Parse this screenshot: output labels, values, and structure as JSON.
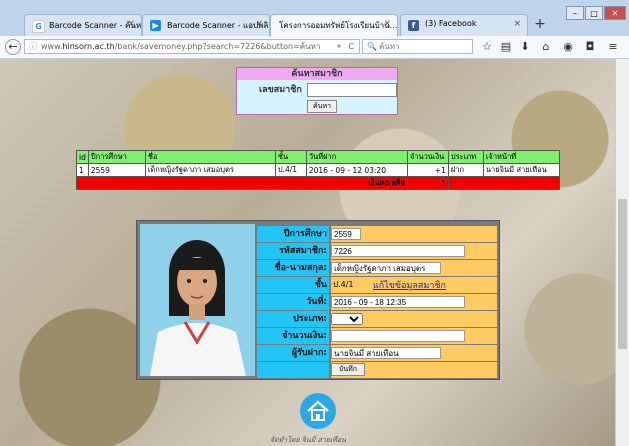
{
  "browser": {
    "tabs": [
      {
        "icon": "G",
        "label": "Barcode Scanner - ค้นหาด้ว...",
        "close": "×"
      },
      {
        "icon": "▶",
        "label": "Barcode Scanner - แอปพลิ...",
        "close": "×"
      },
      {
        "icon": "",
        "label": "โครงการออมทรัพย์โรงเรียนบ้าน...",
        "close": "×"
      },
      {
        "icon": "f",
        "label": "(3) Facebook",
        "close": "×"
      }
    ],
    "new_tab": "+",
    "url_prefix": "www.",
    "url_domain": "hinsorn.ac.th",
    "url_rest": "/bank/savemoney.php?search=7226&button=ค้นหา",
    "search_placeholder": "ค้นหา",
    "accent_color": "#2ca8e6"
  },
  "search_form": {
    "title": "ค้นหาสมาชิก",
    "label": "เลขสมาชิก",
    "value": "",
    "button": "ค้นหา"
  },
  "results": {
    "headers": [
      "id",
      "ปีการศึกษา",
      "ชื่อ",
      "ชั้น",
      "วันที่ฝาก",
      "จำนวนเงิน",
      "ประเภท",
      "เจ้าหน้าที่"
    ],
    "rows": [
      [
        "1",
        "2559",
        "เด็กหญิงรัฐดาภา เสมอบุตร",
        "ป.4/1",
        "2016 - 09 - 12 03:20",
        "+1",
        "ฝาก",
        "นายจินมี่ สายเทือน"
      ]
    ],
    "total_label": "เงินคงเหลือ",
    "total_value": "1"
  },
  "member": {
    "year_label": "ปีการศึกษา",
    "year": "2559",
    "id_label": "รหัสสมาชิก:",
    "id": "7226",
    "name_label": "ชื่อ-นามสกุล:",
    "name": "เด็กหญิงรัฐดาภา เสมอบุตร",
    "class_label": "ชั้น",
    "class": "ป.4/1",
    "edit_link": "แก้ไขข้อมูลสมาชิก",
    "date_label": "วันที่:",
    "date": "2016 - 09 - 18 12:35",
    "type_label": "ประเภท:",
    "type": "",
    "amount_label": "จำนวนเงิน:",
    "amount": "",
    "depositor_label": "ผู้รับฝาก:",
    "depositor": "นายจินมี่ สายเทือน",
    "save_button": "บันทึก"
  },
  "footer": "จัดทำโดย จินมี่ สายเทือน"
}
